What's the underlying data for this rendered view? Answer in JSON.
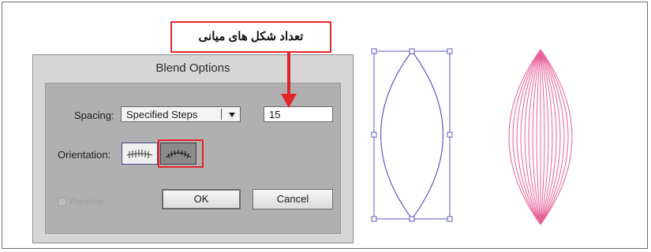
{
  "annotation": {
    "callout_text": "تعداد شکل های میانی"
  },
  "dialog": {
    "title": "Blend Options",
    "spacing_label": "Spacing:",
    "spacing_value": "Specified Steps",
    "steps_value": "15",
    "orientation_label": "Orientation:",
    "preview_label": "Preview",
    "ok_label": "OK",
    "cancel_label": "Cancel"
  },
  "colors": {
    "highlight": "#e2252b",
    "selection_outline": "#5b5bc0",
    "blend_stroke": "#e8609a"
  }
}
